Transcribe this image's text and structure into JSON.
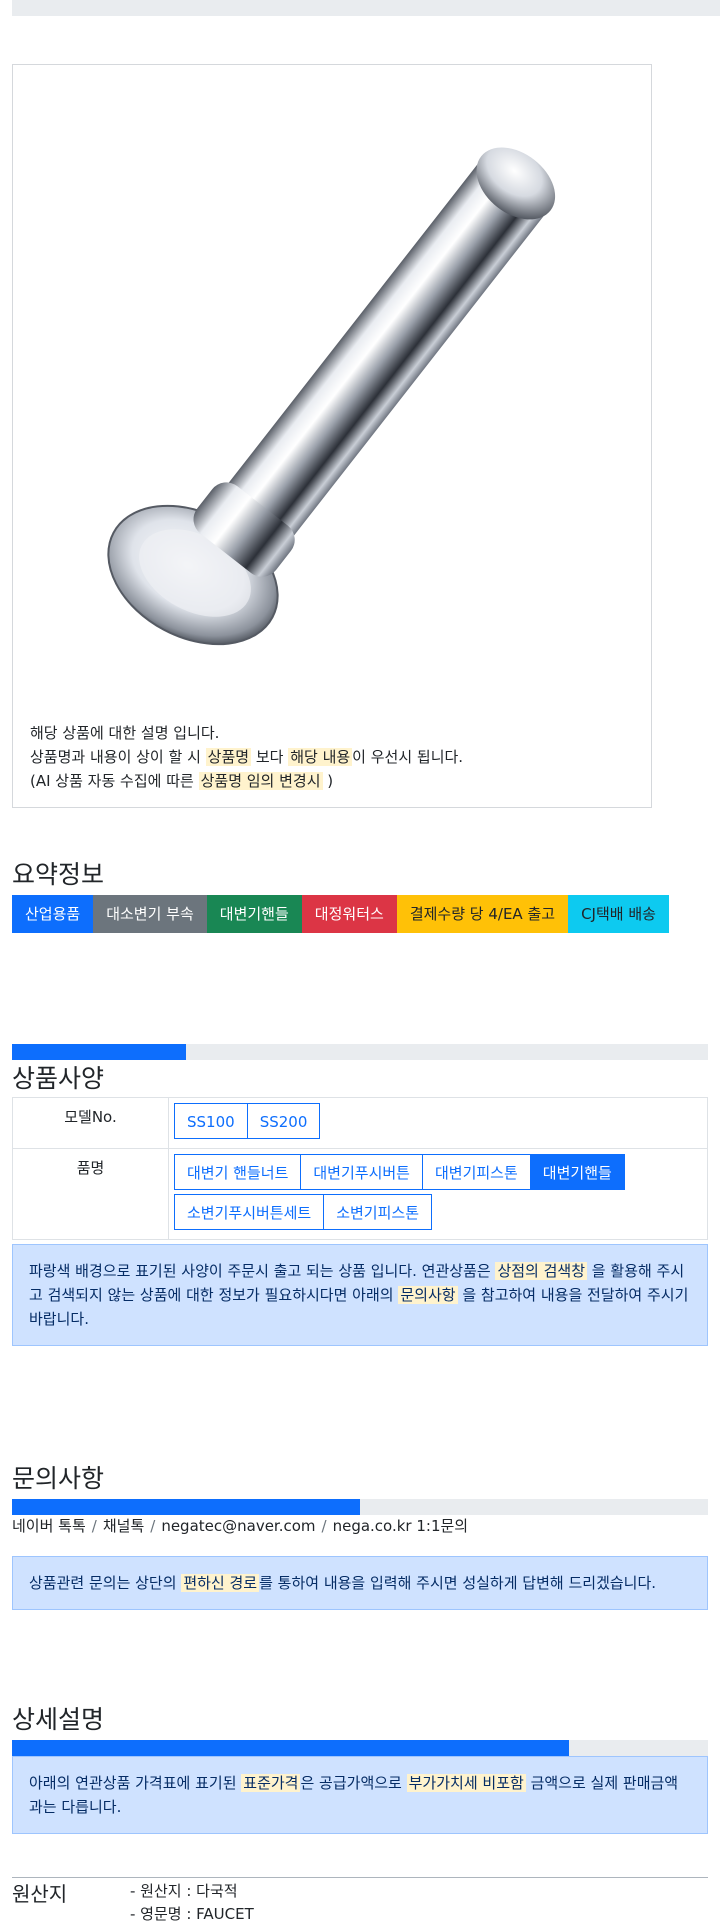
{
  "summary_title": "요약정보",
  "spec_title": "상품사양",
  "inquiry_title": "문의사항",
  "detail_title": "상세설명",
  "product": {
    "desc_line1": "해당 상품에 대한 설명 입니다.",
    "desc_line2": {
      "p1": "상품명과 내용이 상이 할 시 ",
      "h1": "상품명",
      "p2": " 보다 ",
      "h2": "해당 내용",
      "p3": "이 우선시 됩니다."
    },
    "desc_line3": {
      "p1": "(AI 상품 자동 수집에 따른 ",
      "h1": "상품명 임의 변경시",
      "p2": " )"
    }
  },
  "badges": [
    {
      "label": "산업용품",
      "color": "#0d6efd"
    },
    {
      "label": "대소변기 부속",
      "color": "#6c757d"
    },
    {
      "label": "대변기핸들",
      "color": "#198754"
    },
    {
      "label": "대정워터스",
      "color": "#dc3545"
    },
    {
      "label": "결제수량 당 4/EA 출고",
      "color": "#ffc107"
    },
    {
      "label": "CJ택배 배송",
      "color": "#0dcaf0"
    }
  ],
  "progress": {
    "spec": 0.25,
    "inquiry": 0.5,
    "detail": 0.8
  },
  "spec": {
    "model_label": "모델No.",
    "models": [
      "SS100",
      "SS200"
    ],
    "name_label": "품명",
    "names": [
      {
        "label": "대변기 핸들너트",
        "active": false
      },
      {
        "label": "대변기푸시버튼",
        "active": false
      },
      {
        "label": "대변기피스톤",
        "active": false
      },
      {
        "label": "대변기핸들",
        "active": true
      },
      {
        "label": "소변기푸시버튼세트",
        "active": false
      },
      {
        "label": "소변기피스톤",
        "active": false
      }
    ]
  },
  "spec_notice": {
    "p1": "파랑색 배경으로 표기된 사양이 주문시 출고 되는 상품 입니다. 연관상품은 ",
    "h1": "상점의 검색창",
    "p2": " 을 활용해 주시고 검색되지 않는 상품에 대한 정보가 필요하시다면 아래의 ",
    "h2": "문의사항",
    "p3": " 을 참고하여 내용을 전달하여 주시기 바랍니다."
  },
  "contact": [
    "네이버 톡톡",
    "채널톡",
    "negatec@naver.com",
    "nega.co.kr 1:1문의"
  ],
  "inquiry_notice": {
    "p1": "상품관련 문의는 상단의 ",
    "h1": "편하신 경로",
    "p2": "를 통하여 내용을 입력해 주시면 성실하게 답변해 드리겠습니다."
  },
  "detail_notice": {
    "p1": "아래의 연관상품 가격표에 표기된 ",
    "h1": "표준가격",
    "p2": "은 공급가액으로 ",
    "h2": "부가가치세 비포함",
    "p3": " 금액으로 실제 판매금액과는 다릅니다."
  },
  "origin": {
    "label": "원산지",
    "line1": "- 원산지 : 다국적",
    "line2": "- 영문명 : FAUCET"
  }
}
